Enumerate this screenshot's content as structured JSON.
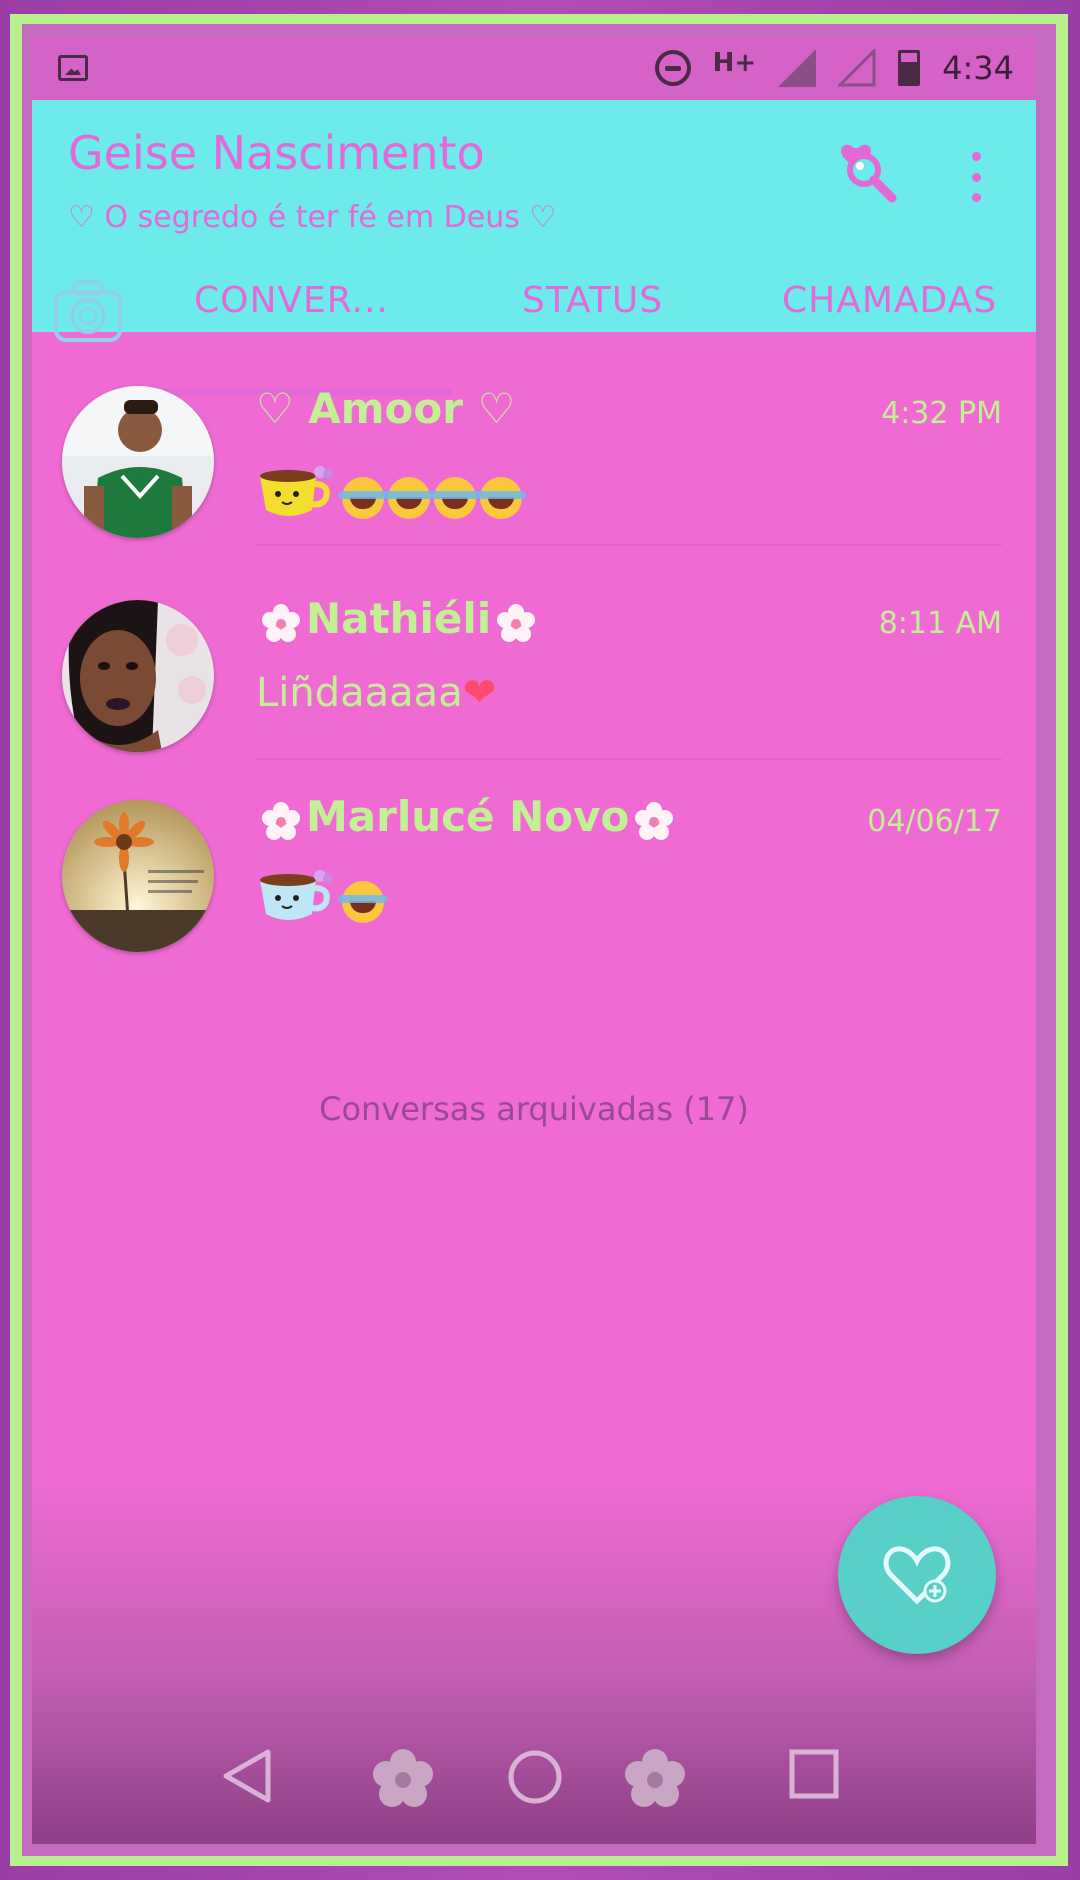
{
  "status_bar": {
    "network_label": "H+",
    "time": "4:34",
    "icons": [
      "image-icon",
      "do-not-disturb-icon",
      "signal-icon",
      "signal-empty-icon",
      "battery-icon"
    ]
  },
  "header": {
    "title": "Geise Nascimento",
    "subtitle": "♡ O segredo é ter fé em Deus ♡",
    "icons": [
      "search-icon",
      "more-icon"
    ]
  },
  "tabs": [
    {
      "label": "CONVER...",
      "active": true
    },
    {
      "label": "STATUS",
      "active": false
    },
    {
      "label": "CHAMADAS",
      "active": false
    }
  ],
  "chats": [
    {
      "name": "♡ Amoor ♡",
      "time": "4:32 PM",
      "message": "",
      "message_icons": [
        "cup-emoji",
        "laughing-emoji",
        "laughing-emoji",
        "laughing-emoji",
        "laughing-emoji"
      ]
    },
    {
      "name": "Nathiéli",
      "time": "8:11 AM",
      "message": "Liñdaaaaa",
      "message_icons": [
        "red-heart-emoji"
      ]
    },
    {
      "name": "Marlucé Novo",
      "time": "04/06/17",
      "message": "",
      "message_icons": [
        "cup-emoji",
        "hugging-emoji"
      ]
    }
  ],
  "archived_label": "Conversas arquivadas (17)",
  "colors": {
    "status_bar": "#d562c6",
    "appbar": "#6deaea",
    "accent_pink": "#e36ad6",
    "background": "#ef6bd3",
    "text_green": "#c3f095",
    "fab": "#58cfc7"
  },
  "navbar": {
    "icons": [
      "back-icon",
      "flower-icon",
      "home-icon",
      "flower-icon",
      "recents-icon"
    ]
  }
}
